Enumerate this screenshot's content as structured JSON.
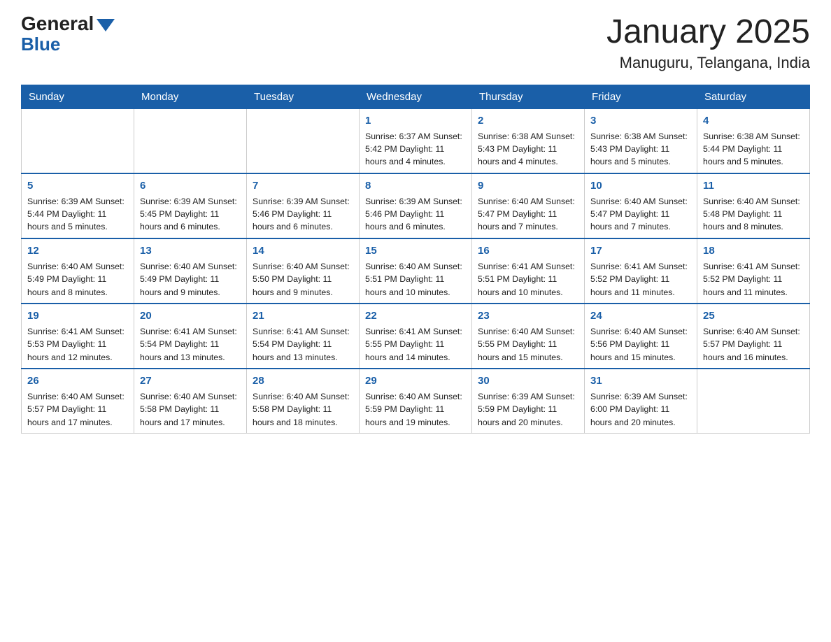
{
  "logo": {
    "general": "General",
    "blue": "Blue"
  },
  "title": "January 2025",
  "subtitle": "Manuguru, Telangana, India",
  "days_header": [
    "Sunday",
    "Monday",
    "Tuesday",
    "Wednesday",
    "Thursday",
    "Friday",
    "Saturday"
  ],
  "weeks": [
    [
      {
        "num": "",
        "info": ""
      },
      {
        "num": "",
        "info": ""
      },
      {
        "num": "",
        "info": ""
      },
      {
        "num": "1",
        "info": "Sunrise: 6:37 AM\nSunset: 5:42 PM\nDaylight: 11 hours and 4 minutes."
      },
      {
        "num": "2",
        "info": "Sunrise: 6:38 AM\nSunset: 5:43 PM\nDaylight: 11 hours and 4 minutes."
      },
      {
        "num": "3",
        "info": "Sunrise: 6:38 AM\nSunset: 5:43 PM\nDaylight: 11 hours and 5 minutes."
      },
      {
        "num": "4",
        "info": "Sunrise: 6:38 AM\nSunset: 5:44 PM\nDaylight: 11 hours and 5 minutes."
      }
    ],
    [
      {
        "num": "5",
        "info": "Sunrise: 6:39 AM\nSunset: 5:44 PM\nDaylight: 11 hours and 5 minutes."
      },
      {
        "num": "6",
        "info": "Sunrise: 6:39 AM\nSunset: 5:45 PM\nDaylight: 11 hours and 6 minutes."
      },
      {
        "num": "7",
        "info": "Sunrise: 6:39 AM\nSunset: 5:46 PM\nDaylight: 11 hours and 6 minutes."
      },
      {
        "num": "8",
        "info": "Sunrise: 6:39 AM\nSunset: 5:46 PM\nDaylight: 11 hours and 6 minutes."
      },
      {
        "num": "9",
        "info": "Sunrise: 6:40 AM\nSunset: 5:47 PM\nDaylight: 11 hours and 7 minutes."
      },
      {
        "num": "10",
        "info": "Sunrise: 6:40 AM\nSunset: 5:47 PM\nDaylight: 11 hours and 7 minutes."
      },
      {
        "num": "11",
        "info": "Sunrise: 6:40 AM\nSunset: 5:48 PM\nDaylight: 11 hours and 8 minutes."
      }
    ],
    [
      {
        "num": "12",
        "info": "Sunrise: 6:40 AM\nSunset: 5:49 PM\nDaylight: 11 hours and 8 minutes."
      },
      {
        "num": "13",
        "info": "Sunrise: 6:40 AM\nSunset: 5:49 PM\nDaylight: 11 hours and 9 minutes."
      },
      {
        "num": "14",
        "info": "Sunrise: 6:40 AM\nSunset: 5:50 PM\nDaylight: 11 hours and 9 minutes."
      },
      {
        "num": "15",
        "info": "Sunrise: 6:40 AM\nSunset: 5:51 PM\nDaylight: 11 hours and 10 minutes."
      },
      {
        "num": "16",
        "info": "Sunrise: 6:41 AM\nSunset: 5:51 PM\nDaylight: 11 hours and 10 minutes."
      },
      {
        "num": "17",
        "info": "Sunrise: 6:41 AM\nSunset: 5:52 PM\nDaylight: 11 hours and 11 minutes."
      },
      {
        "num": "18",
        "info": "Sunrise: 6:41 AM\nSunset: 5:52 PM\nDaylight: 11 hours and 11 minutes."
      }
    ],
    [
      {
        "num": "19",
        "info": "Sunrise: 6:41 AM\nSunset: 5:53 PM\nDaylight: 11 hours and 12 minutes."
      },
      {
        "num": "20",
        "info": "Sunrise: 6:41 AM\nSunset: 5:54 PM\nDaylight: 11 hours and 13 minutes."
      },
      {
        "num": "21",
        "info": "Sunrise: 6:41 AM\nSunset: 5:54 PM\nDaylight: 11 hours and 13 minutes."
      },
      {
        "num": "22",
        "info": "Sunrise: 6:41 AM\nSunset: 5:55 PM\nDaylight: 11 hours and 14 minutes."
      },
      {
        "num": "23",
        "info": "Sunrise: 6:40 AM\nSunset: 5:55 PM\nDaylight: 11 hours and 15 minutes."
      },
      {
        "num": "24",
        "info": "Sunrise: 6:40 AM\nSunset: 5:56 PM\nDaylight: 11 hours and 15 minutes."
      },
      {
        "num": "25",
        "info": "Sunrise: 6:40 AM\nSunset: 5:57 PM\nDaylight: 11 hours and 16 minutes."
      }
    ],
    [
      {
        "num": "26",
        "info": "Sunrise: 6:40 AM\nSunset: 5:57 PM\nDaylight: 11 hours and 17 minutes."
      },
      {
        "num": "27",
        "info": "Sunrise: 6:40 AM\nSunset: 5:58 PM\nDaylight: 11 hours and 17 minutes."
      },
      {
        "num": "28",
        "info": "Sunrise: 6:40 AM\nSunset: 5:58 PM\nDaylight: 11 hours and 18 minutes."
      },
      {
        "num": "29",
        "info": "Sunrise: 6:40 AM\nSunset: 5:59 PM\nDaylight: 11 hours and 19 minutes."
      },
      {
        "num": "30",
        "info": "Sunrise: 6:39 AM\nSunset: 5:59 PM\nDaylight: 11 hours and 20 minutes."
      },
      {
        "num": "31",
        "info": "Sunrise: 6:39 AM\nSunset: 6:00 PM\nDaylight: 11 hours and 20 minutes."
      },
      {
        "num": "",
        "info": ""
      }
    ]
  ]
}
